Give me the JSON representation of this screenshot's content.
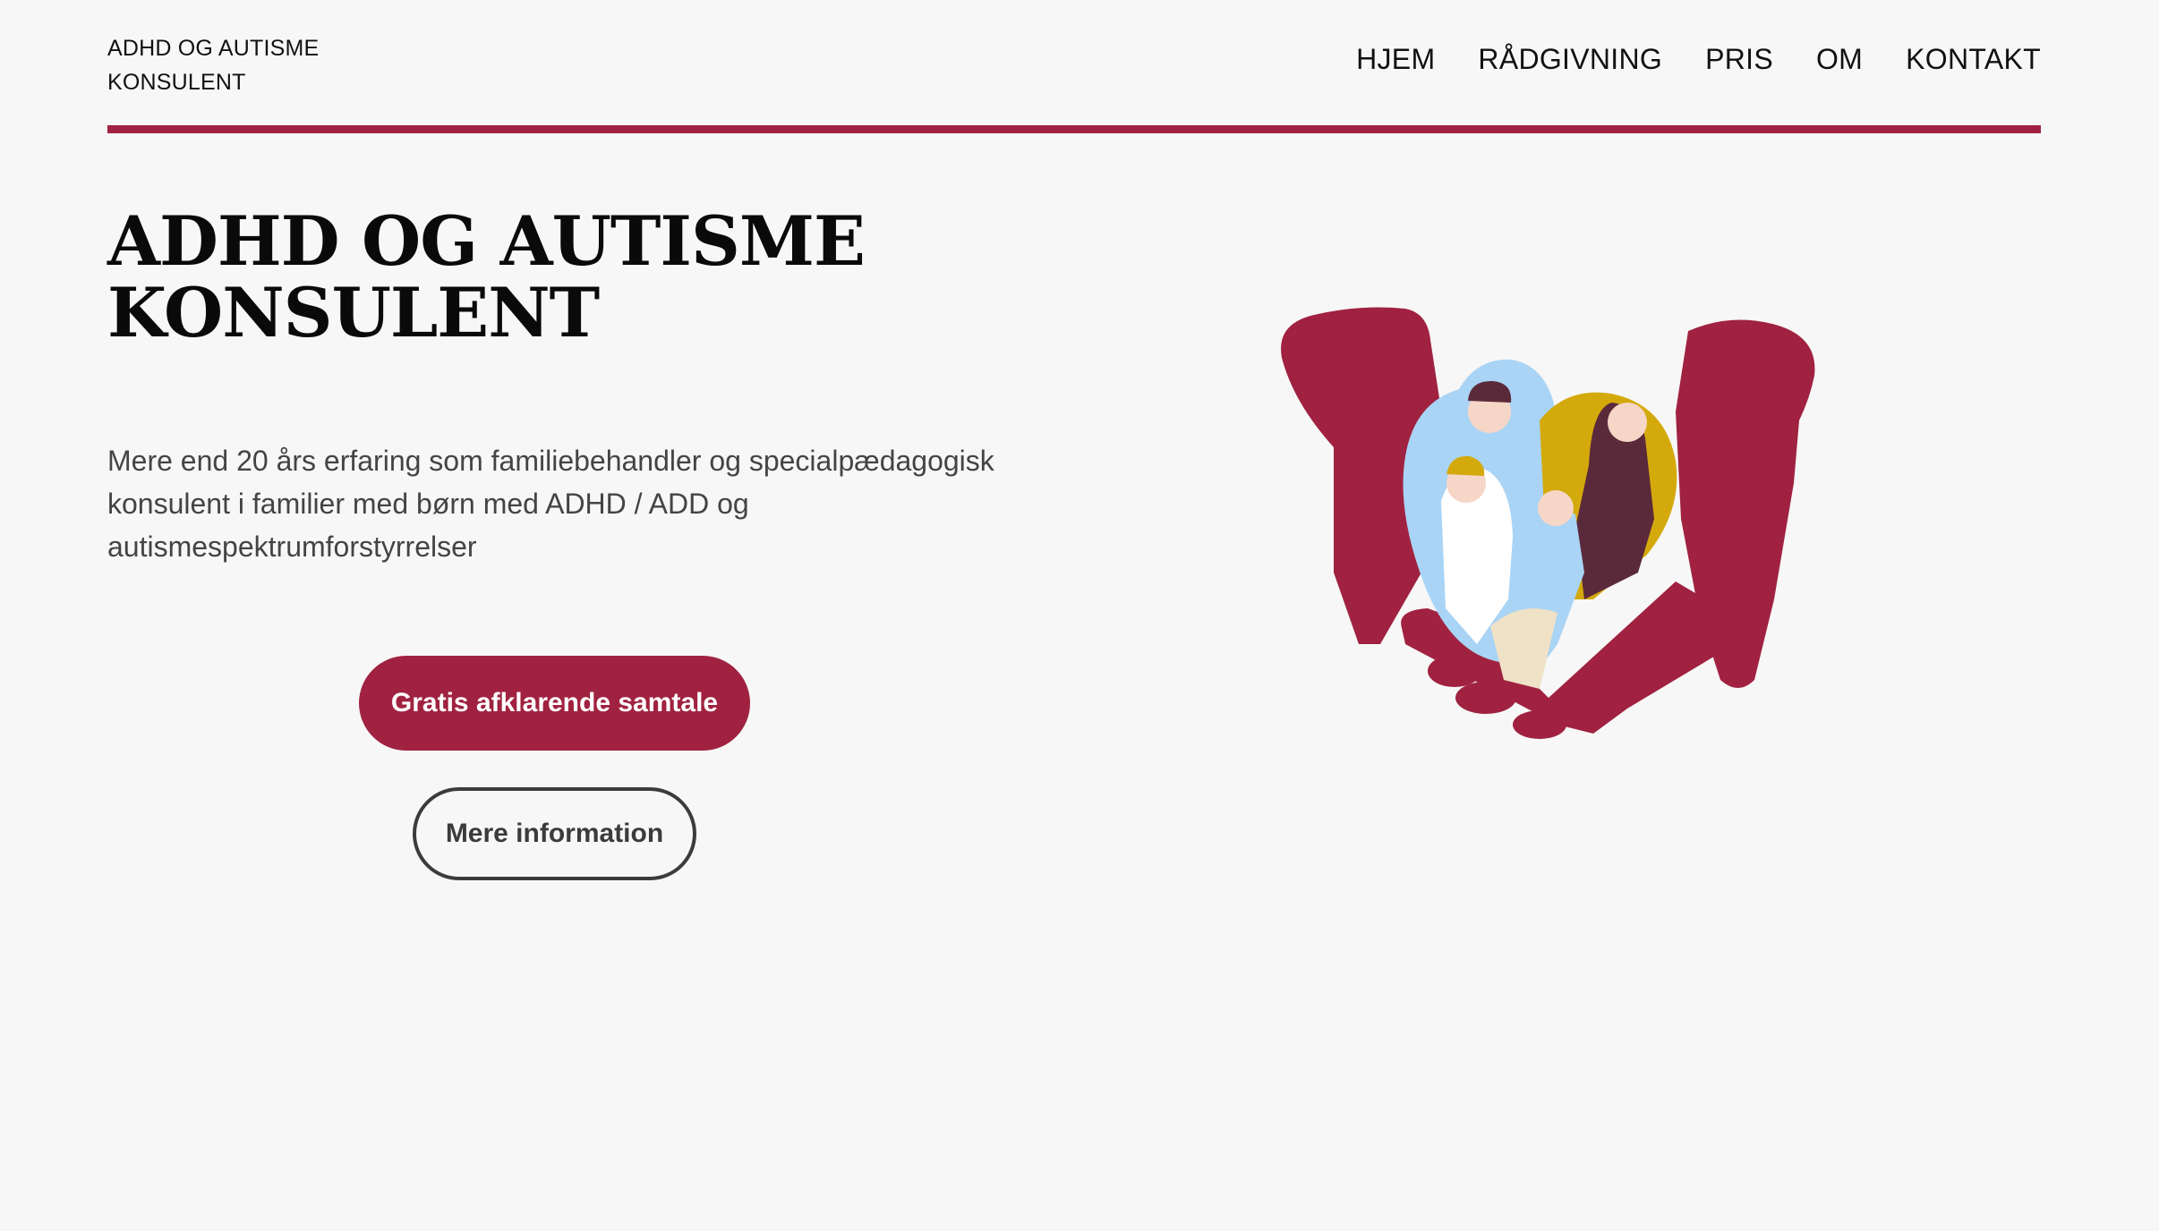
{
  "header": {
    "brand_line1": "ADHD OG AUTISME",
    "brand_line2": "KONSULENT",
    "nav": [
      {
        "label": "HJEM"
      },
      {
        "label": "RÅDGIVNING"
      },
      {
        "label": "PRIS"
      },
      {
        "label": "OM"
      },
      {
        "label": "KONTAKT"
      }
    ]
  },
  "hero": {
    "title_line1": "ADHD OG AUTISME",
    "title_line2": "KONSULENT",
    "description": "Mere end 20 års erfaring som familiebehandler og specialpædagogisk konsulent i familier med børn med ADHD / ADD og autismespektrumforstyrrelser",
    "primary_button": "Gratis afklarende samtale",
    "secondary_button": "Mere information",
    "illustration_icon": "family-in-hands-heart-illustration"
  },
  "colors": {
    "accent": "#a02240",
    "background": "#f7f7f7",
    "text": "#111111",
    "muted_text": "#444444",
    "illustration_blue": "#a9d4f5",
    "illustration_yellow": "#d4a90c",
    "illustration_dark": "#5b2a3a"
  }
}
